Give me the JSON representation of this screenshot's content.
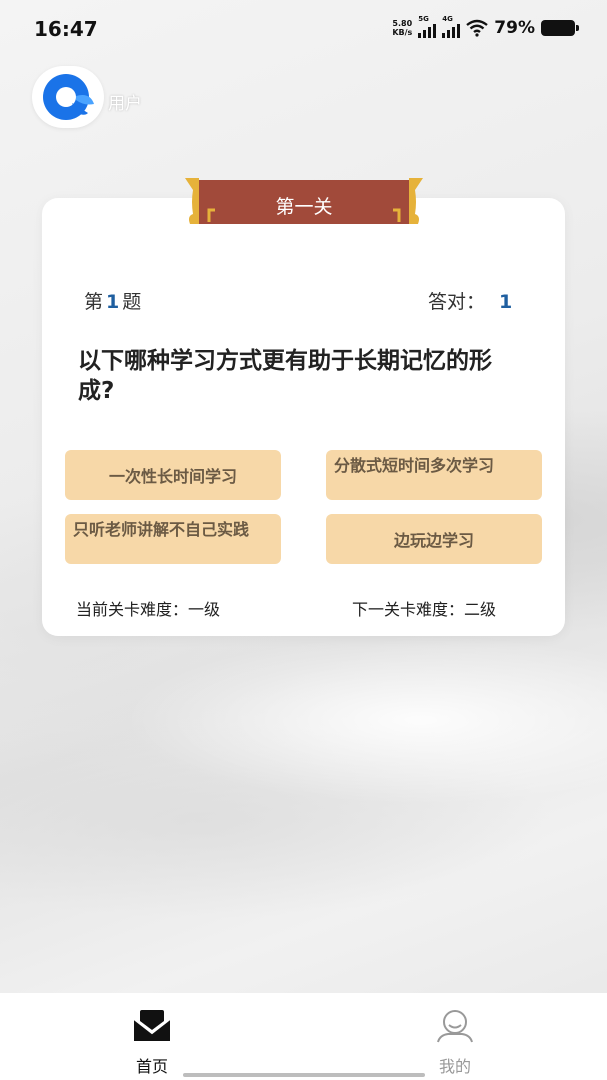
{
  "status_bar": {
    "time": "16:47",
    "net_speed_value": "5.80",
    "net_speed_unit": "KB/s",
    "signal_1_label": "5G",
    "signal_2_label": "4G",
    "battery_percent": "79%"
  },
  "header": {
    "user_label": "用户"
  },
  "level": {
    "banner_title": "第一关",
    "question_prefix": "第",
    "question_number": "1",
    "question_suffix": "题",
    "correct_label": "答对：",
    "correct_count": "1",
    "question_text": "以下哪种学习方式更有助于长期记忆的形成?",
    "options": [
      {
        "label": "一次性长时间学习"
      },
      {
        "label": "分散式短时间多次学习"
      },
      {
        "label": "只听老师讲解不自己实践"
      },
      {
        "label": "边玩边学习"
      }
    ],
    "current_difficulty": "当前关卡难度：一级",
    "next_difficulty": "下一关卡难度：二级"
  },
  "tabbar": {
    "items": [
      {
        "label": "首页",
        "icon": "home-icon",
        "active": true
      },
      {
        "label": "我的",
        "icon": "profile-icon",
        "active": false
      }
    ]
  },
  "colors": {
    "option_bg": "#f7d8a8",
    "banner_red": "#a14a3a",
    "banner_gold": "#e6b23a",
    "accent_blue": "#1f5fa0",
    "logo_blue": "#1a73e8"
  }
}
